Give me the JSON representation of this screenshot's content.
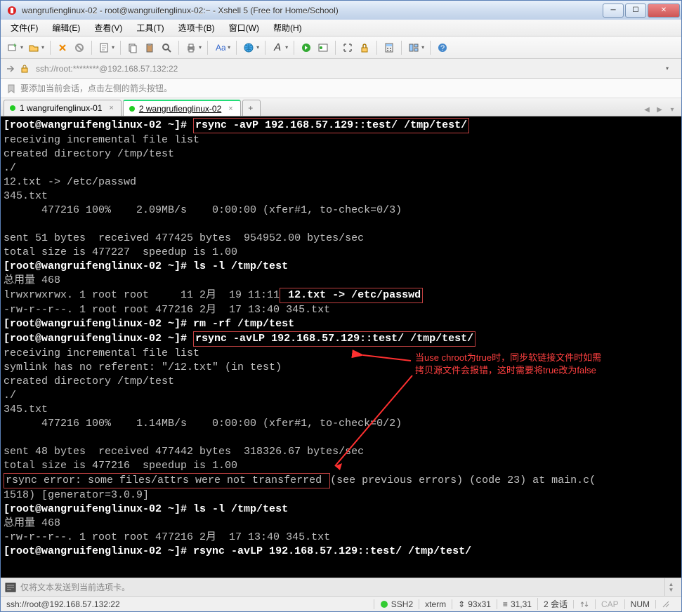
{
  "window": {
    "title": "wangrufienglinux-02 - root@wangruifenglinux-02:~ - Xshell 5 (Free for Home/School)"
  },
  "menus": {
    "file": "文件(F)",
    "edit": "编辑(E)",
    "view": "查看(V)",
    "tools": "工具(T)",
    "tabs": "选项卡(B)",
    "window": "窗口(W)",
    "help": "帮助(H)"
  },
  "address": {
    "text": "ssh://root:********@192.168.57.132:22"
  },
  "hint": {
    "text": "要添加当前会话，点击左侧的箭头按钮。"
  },
  "tabs": {
    "t1": "1 wangruifenglinux-01",
    "t2": "2 wangrufienglinux-02"
  },
  "terminal": {
    "l1a": "[root@wangruifenglinux-02 ~]# ",
    "l1b": "rsync -avP 192.168.57.129::test/ /tmp/test/",
    "l2": "receiving incremental file list",
    "l3": "created directory /tmp/test",
    "l4": "./",
    "l5": "12.txt -> /etc/passwd",
    "l6": "345.txt",
    "l7": "      477216 100%    2.09MB/s    0:00:00 (xfer#1, to-check=0/3)",
    "l9": "sent 51 bytes  received 477425 bytes  954952.00 bytes/sec",
    "l10": "total size is 477227  speedup is 1.00",
    "l11": "[root@wangruifenglinux-02 ~]# ls -l /tmp/test",
    "l12": "总用量 468",
    "l13a": "lrwxrwxrwx. 1 root root     11 2月  19 11:11",
    "l13b": " 12.txt -> /etc/passwd",
    "l14": "-rw-r--r--. 1 root root 477216 2月  17 13:40 345.txt",
    "l15": "[root@wangruifenglinux-02 ~]# rm -rf /tmp/test",
    "l16a": "[root@wangruifenglinux-02 ~]# ",
    "l16b": "rsync -avLP 192.168.57.129::test/ /tmp/test/",
    "l17": "receiving incremental file list",
    "l18": "symlink has no referent: \"/12.txt\" (in test)",
    "l19": "created directory /tmp/test",
    "l20": "./",
    "l21": "345.txt",
    "l22": "      477216 100%    1.14MB/s    0:00:00 (xfer#1, to-check=0/2)",
    "l24": "sent 48 bytes  received 477442 bytes  318326.67 bytes/sec",
    "l25": "total size is 477216  speedup is 1.00",
    "l26a": "rsync error: some files/attrs were not transferred ",
    "l26b": "(see previous errors) (code 23) at main.c(",
    "l27": "1518) [generator=3.0.9]",
    "l28": "[root@wangruifenglinux-02 ~]# ls -l /tmp/test",
    "l29": "总用量 468",
    "l30": "-rw-r--r--. 1 root root 477216 2月  17 13:40 345.txt",
    "l31": "[root@wangruifenglinux-02 ~]# rsync -avLP 192.168.57.129::test/ /tmp/test/",
    "annotation1": "当use chroot为true时，同步软链接文件时如需",
    "annotation2": "拷贝源文件会报错，这时需要将true改为false"
  },
  "bottom": {
    "placeholder": "仅将文本发送到当前选项卡。"
  },
  "status": {
    "conn": "ssh://root@192.168.57.132:22",
    "proto": "SSH2",
    "term": "xterm",
    "size": "93x31",
    "pos": "31,31",
    "sessions": "2 会话",
    "cap": "CAP",
    "num": "NUM"
  }
}
